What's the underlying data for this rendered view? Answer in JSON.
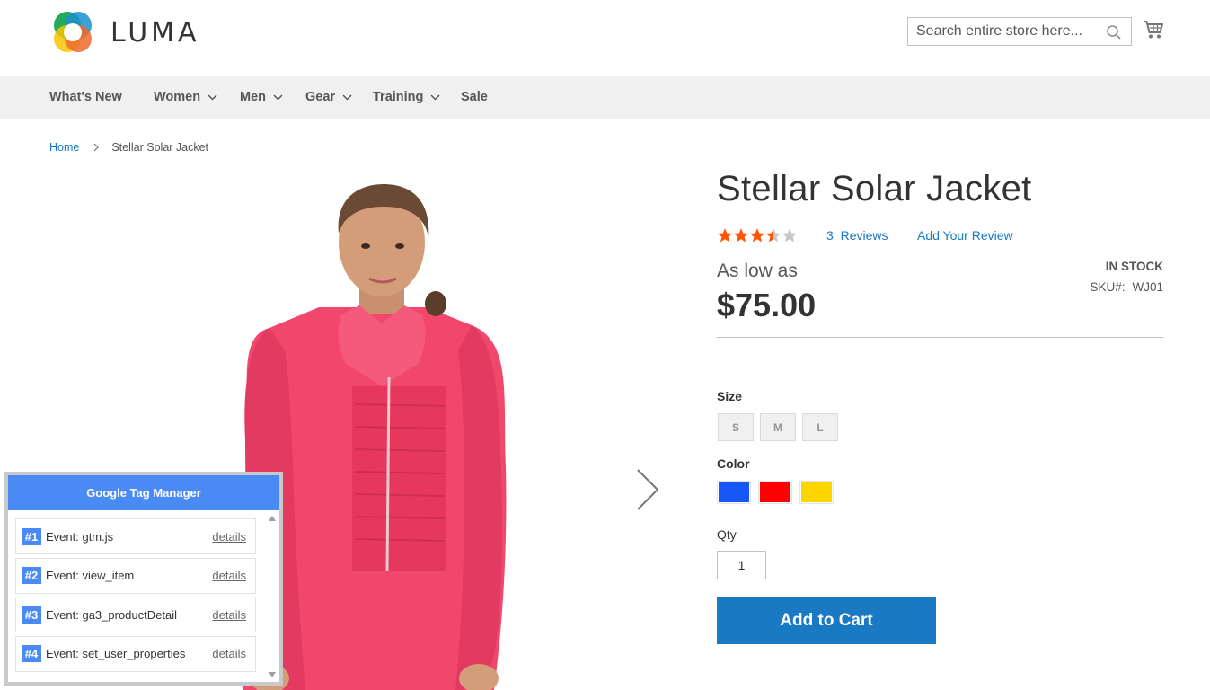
{
  "header": {
    "logo_text": "LUMA",
    "search_placeholder": "Search entire store here..."
  },
  "nav": {
    "items": [
      {
        "label": "What's New"
      },
      {
        "label": "Women"
      },
      {
        "label": "Men"
      },
      {
        "label": "Gear"
      },
      {
        "label": "Training"
      },
      {
        "label": "Sale"
      }
    ]
  },
  "breadcrumb": {
    "home": "Home",
    "current": "Stellar Solar Jacket"
  },
  "product": {
    "title": "Stellar Solar Jacket",
    "rating": 3.5,
    "rating_max": 5,
    "reviews_count": "3",
    "reviews_label": "Reviews",
    "add_review": "Add Your Review",
    "price_label": "As low as",
    "price": "$75.00",
    "stock": "IN STOCK",
    "sku_label": "SKU#:",
    "sku": "WJ01",
    "size_label": "Size",
    "sizes": [
      "S",
      "M",
      "L"
    ],
    "color_label": "Color",
    "colors": [
      "#1857f7",
      "#ff0000",
      "#ffd500"
    ],
    "qty_label": "Qty",
    "qty_value": "1",
    "add_to_cart": "Add to Cart",
    "star_color": "#ff5501",
    "accent": "#1979c3"
  },
  "gtm": {
    "title": "Google Tag Manager",
    "details_label": "details",
    "events": [
      {
        "num": "#1",
        "label": "Event: gtm.js"
      },
      {
        "num": "#2",
        "label": "Event: view_item"
      },
      {
        "num": "#3",
        "label": "Event: ga3_productDetail"
      },
      {
        "num": "#4",
        "label": "Event: set_user_properties"
      }
    ]
  }
}
